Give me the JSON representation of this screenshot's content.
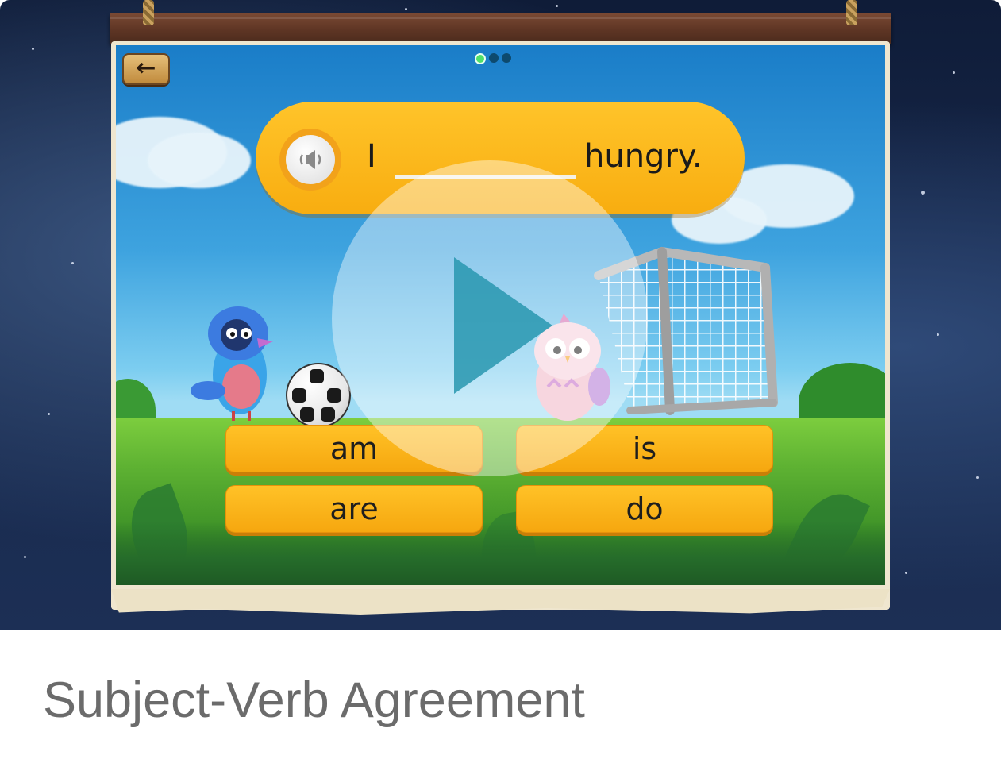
{
  "game": {
    "question": {
      "subject": "I",
      "ending": "hungry."
    },
    "progress": {
      "current": 1,
      "total": 3
    },
    "answers": [
      {
        "label": "am"
      },
      {
        "label": "is"
      },
      {
        "label": "are"
      },
      {
        "label": "do"
      }
    ],
    "icons": {
      "back": "arrow-left-icon",
      "audio": "speaker-icon",
      "play": "play-icon"
    }
  },
  "card": {
    "title": "Subject-Verb Agreement"
  },
  "colors": {
    "answer_bg": "#ffc227",
    "sky": "#3ea3df",
    "title_text": "#6b6b6b"
  }
}
